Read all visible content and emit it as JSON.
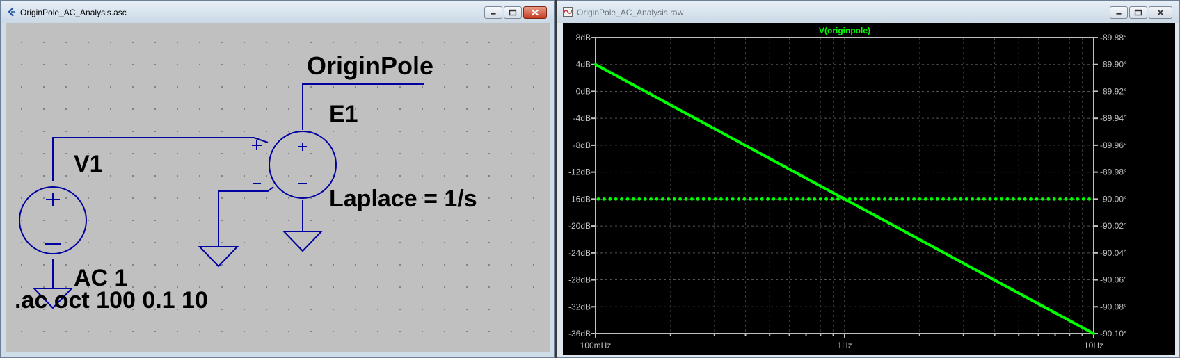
{
  "schematic_window": {
    "title": "OriginPole_AC_Analysis.asc",
    "labels": {
      "net": "OriginPole",
      "source_name": "V1",
      "source_value": "AC 1",
      "component_name": "E1",
      "component_value": "Laplace = 1/s",
      "directive": ".ac oct 100 0.1 10",
      "pin_plus": "+",
      "pin_minus": "–"
    },
    "colors": {
      "wire": "#0000a0",
      "background": "#c0c0c0",
      "text": "#000000"
    }
  },
  "waveform_window": {
    "title": "OriginPole_AC_Analysis.raw",
    "trace_name": "V(originpole)",
    "colors": {
      "trace": "#00ff00",
      "background": "#000000",
      "axis": "#c0c0c0"
    }
  },
  "chart_data": {
    "type": "line",
    "title": "V(originpole)",
    "x_scale": "log",
    "x_unit": "Hz",
    "xlim": [
      0.1,
      10
    ],
    "x_tick_labels": [
      "100mHz",
      "1Hz",
      "10Hz"
    ],
    "y_left_label_ticks": [
      "8dB",
      "4dB",
      "0dB",
      "-4dB",
      "-8dB",
      "-12dB",
      "-16dB",
      "-20dB",
      "-24dB",
      "-28dB",
      "-32dB",
      "-36dB"
    ],
    "y_left_lim": [
      -36,
      8
    ],
    "y_right_label_ticks": [
      "-89.88°",
      "-89.90°",
      "-89.92°",
      "-89.94°",
      "-89.96°",
      "-89.98°",
      "-90.00°",
      "-90.02°",
      "-90.04°",
      "-90.06°",
      "-90.08°",
      "-90.10°"
    ],
    "y_right_lim": [
      -90.1,
      -89.88
    ],
    "grid": true,
    "series": [
      {
        "name": "V(originpole)",
        "axis": "left",
        "style": "solid",
        "x": [
          0.1,
          1,
          10
        ],
        "y": [
          4,
          -16,
          -36
        ]
      },
      {
        "name": "V(originpole)",
        "axis": "right",
        "style": "dotted",
        "x": [
          0.1,
          10
        ],
        "y": [
          -90.0,
          -90.0
        ]
      }
    ]
  }
}
